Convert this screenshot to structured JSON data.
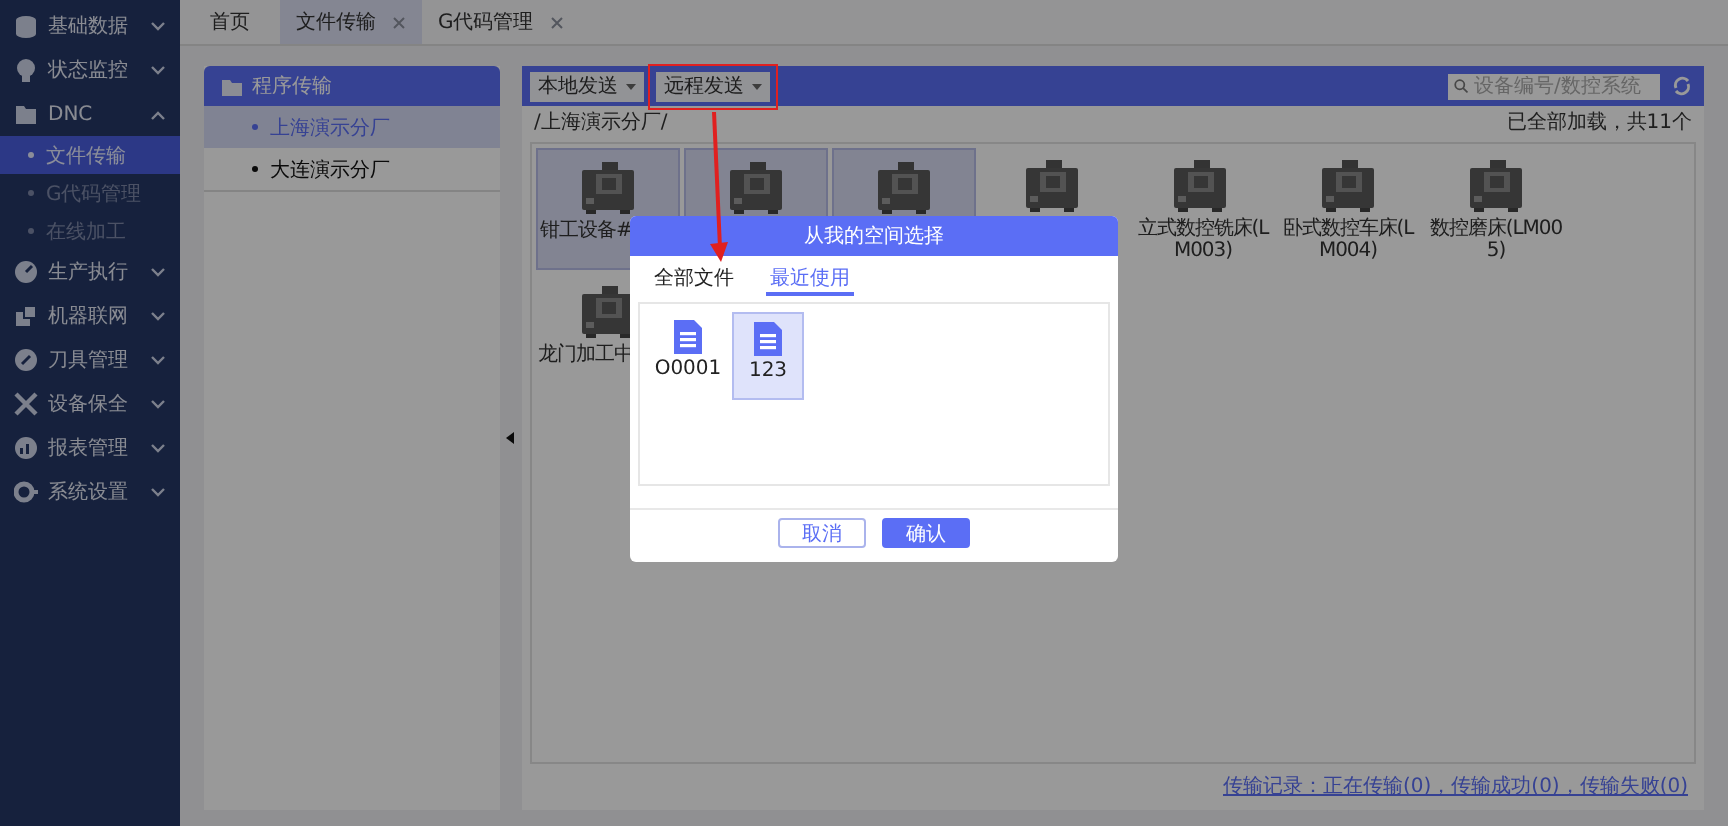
{
  "sidebar": {
    "items": [
      {
        "label": "基础数据",
        "expanded": false
      },
      {
        "label": "状态监控",
        "expanded": false
      },
      {
        "label": "DNC",
        "expanded": true,
        "children": [
          {
            "label": "文件传输",
            "selected": true
          },
          {
            "label": "G代码管理",
            "selected": false
          },
          {
            "label": "在线加工",
            "selected": false
          }
        ]
      },
      {
        "label": "生产执行",
        "expanded": false
      },
      {
        "label": "机器联网",
        "expanded": false
      },
      {
        "label": "刀具管理",
        "expanded": false
      },
      {
        "label": "设备保全",
        "expanded": false
      },
      {
        "label": "报表管理",
        "expanded": false
      },
      {
        "label": "系统设置",
        "expanded": false
      }
    ]
  },
  "tabs": [
    {
      "label": "首页",
      "selected": false,
      "closable": false
    },
    {
      "label": "文件传输",
      "selected": true,
      "closable": true
    },
    {
      "label": "G代码管理",
      "selected": false,
      "closable": true
    }
  ],
  "tree_panel": {
    "title": "程序传输",
    "items": [
      {
        "label": "上海演示分厂",
        "selected": true
      },
      {
        "label": "大连演示分厂",
        "selected": false
      }
    ]
  },
  "toolbar": {
    "dropdowns": [
      "本地发送",
      "远程发送"
    ],
    "search": {
      "placeholder": "设备编号/数控系统"
    }
  },
  "path": "/上海演示分厂/",
  "count": "已全部加载，共11个",
  "devices": [
    {
      "label": "钳工设备#",
      "selected": true
    },
    {
      "selected": true
    },
    {
      "selected": true
    },
    {
      "selected": false
    },
    {
      "label": "立式数控铣床(LM003)",
      "selected": false
    },
    {
      "label": "卧式数控车床(LM004)",
      "selected": false
    },
    {
      "label": "数控磨床(LM005)",
      "selected": false
    },
    {
      "label": "龙门加工中",
      "selected": false
    }
  ],
  "transfer_log": "传输记录：正在传输(0)，传输成功(0)，传输失败(0)",
  "dialog": {
    "title": "从我的空间选择",
    "tabs": [
      {
        "label": "全部文件",
        "selected": false
      },
      {
        "label": "最近使用",
        "selected": true
      }
    ],
    "files": [
      {
        "name": "O0001",
        "selected": false
      },
      {
        "name": "123",
        "selected": true
      }
    ],
    "buttons": [
      {
        "label": "取消",
        "kind": "secondary"
      },
      {
        "label": "确认",
        "kind": "primary"
      }
    ]
  }
}
